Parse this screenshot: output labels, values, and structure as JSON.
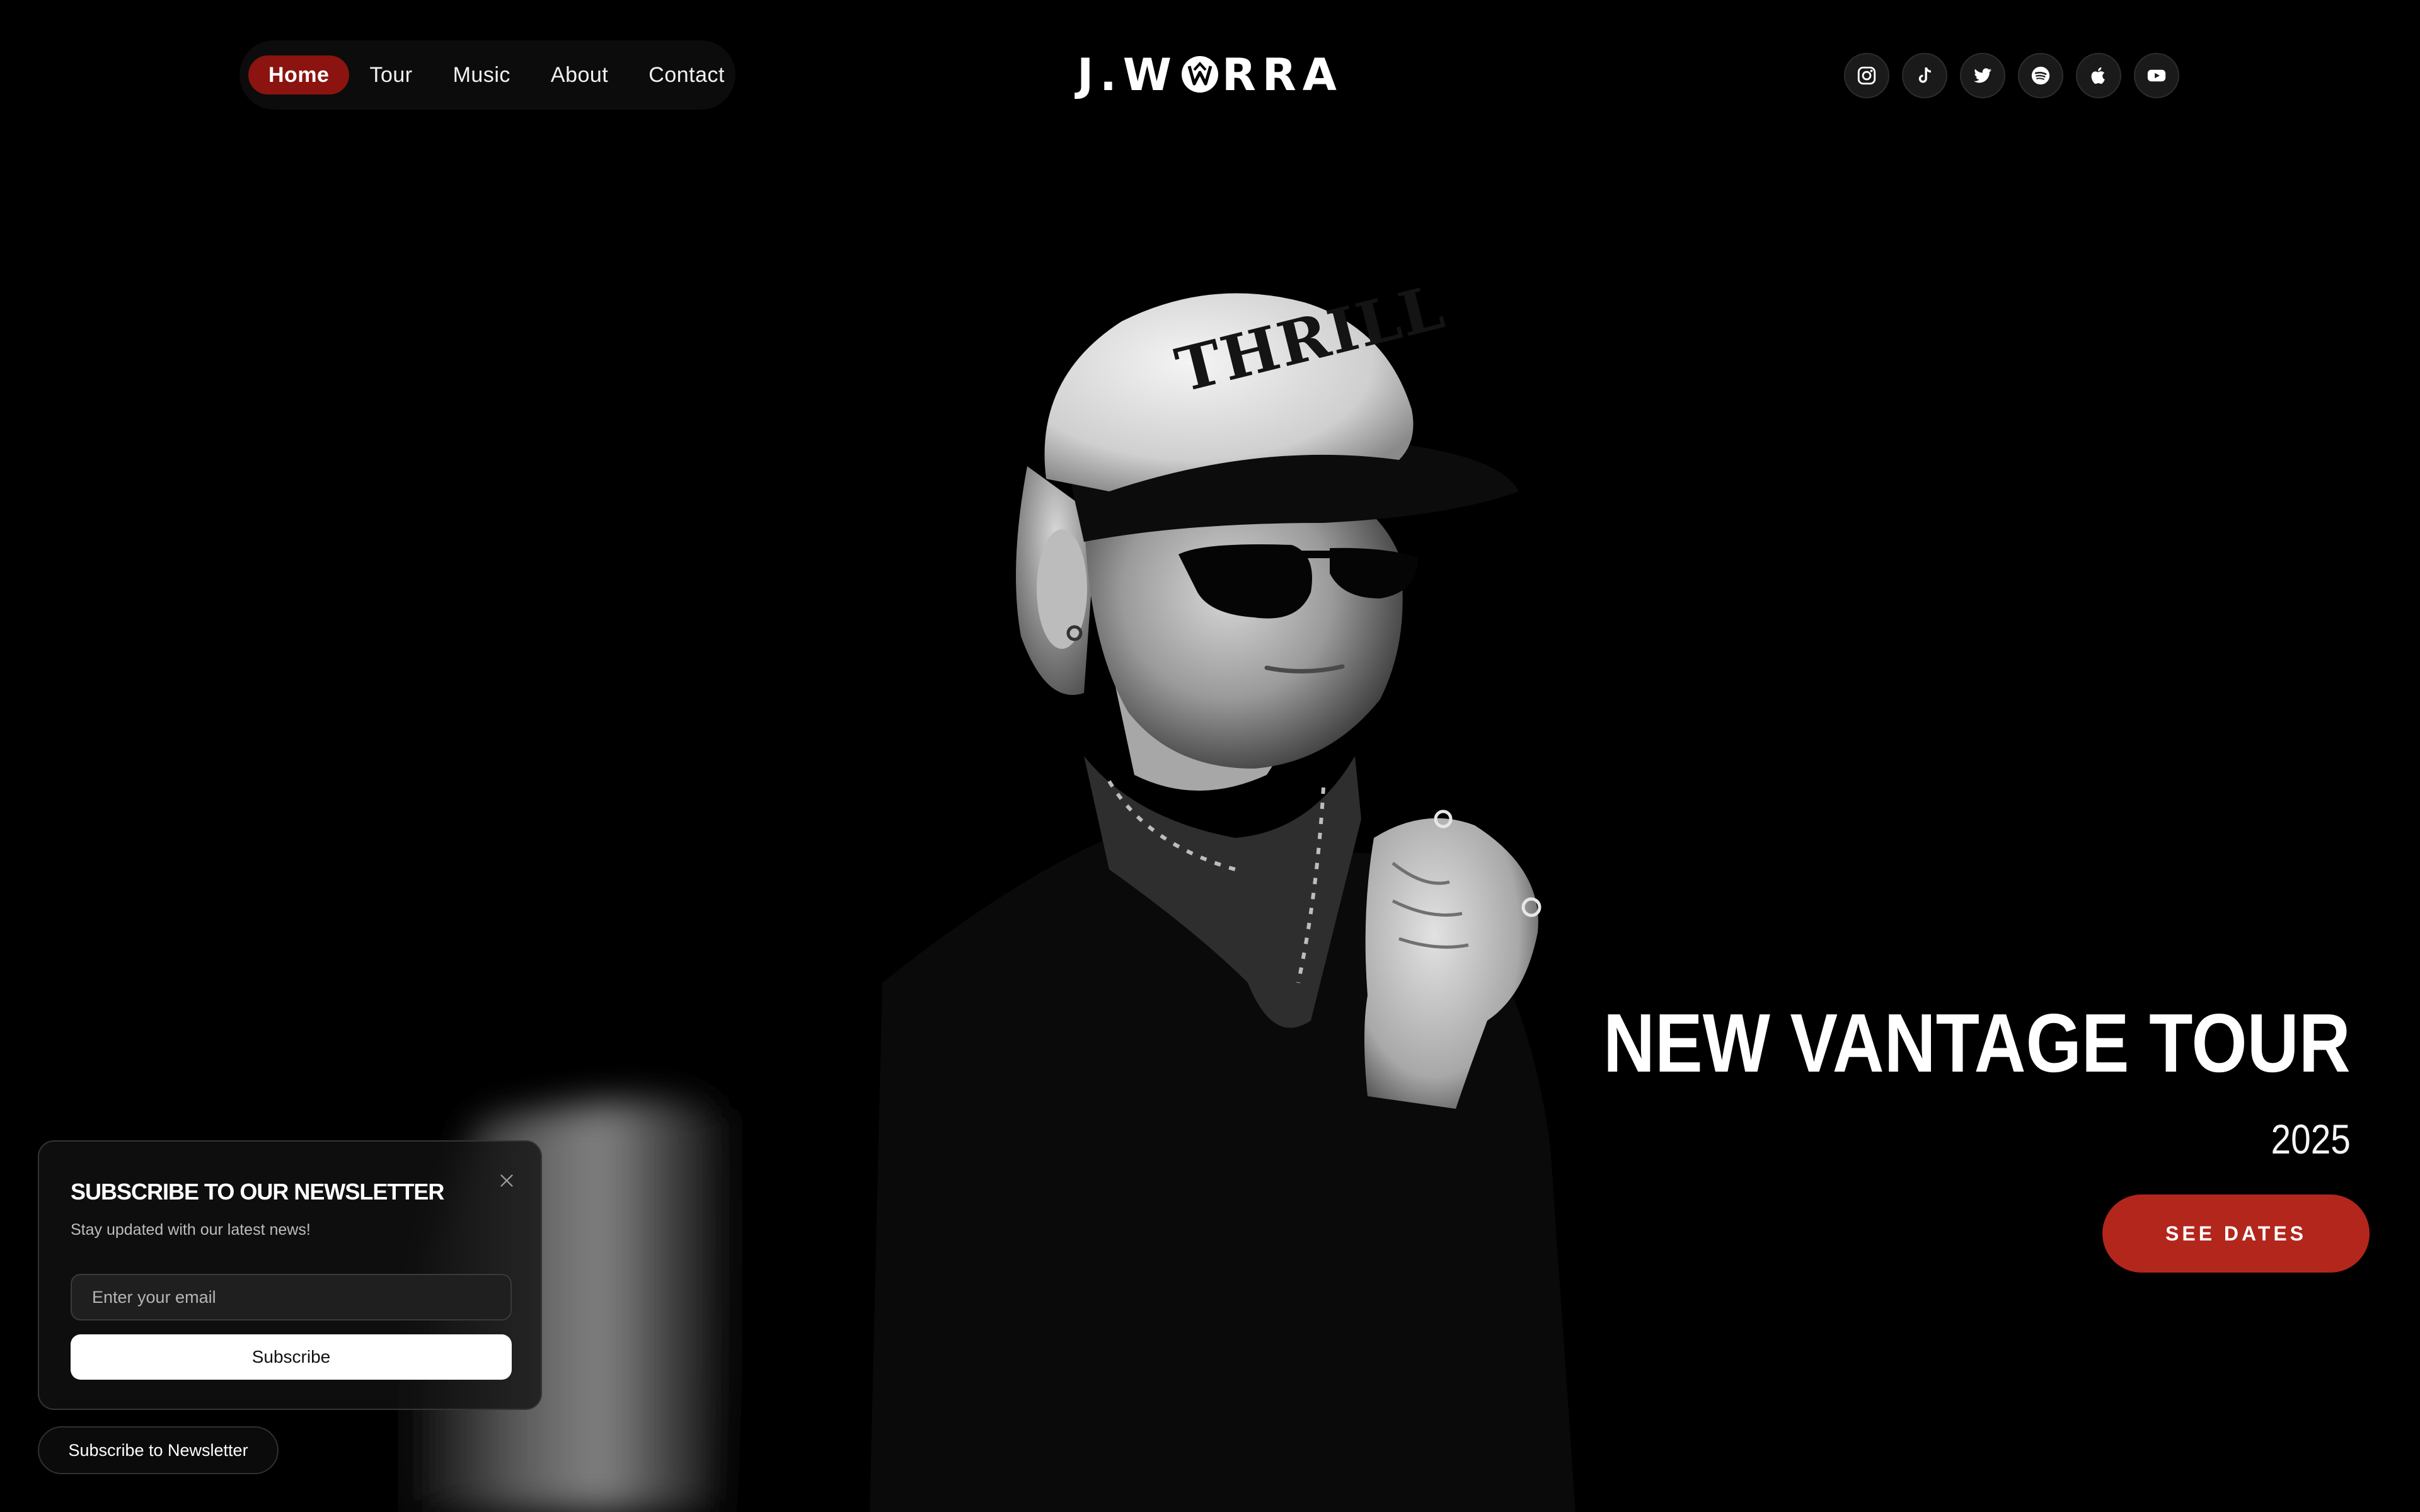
{
  "nav": {
    "items": [
      {
        "label": "Home",
        "active": true
      },
      {
        "label": "Tour",
        "active": false
      },
      {
        "label": "Music",
        "active": false
      },
      {
        "label": "About",
        "active": false
      },
      {
        "label": "Contact",
        "active": false
      }
    ]
  },
  "brand": {
    "logo_pre": "J.W",
    "logo_post": "RRA"
  },
  "social": [
    {
      "icon": "instagram-icon"
    },
    {
      "icon": "tiktok-icon"
    },
    {
      "icon": "twitter-icon"
    },
    {
      "icon": "spotify-icon"
    },
    {
      "icon": "apple-music-icon"
    },
    {
      "icon": "youtube-icon"
    }
  ],
  "hero": {
    "title": "NEW VANTAGE TOUR",
    "year": "2025",
    "cta_label": "SEE DATES",
    "cap_text": "THRILL"
  },
  "newsletter": {
    "title": "SUBSCRIBE TO OUR NEWSLETTER",
    "subtitle": "Stay updated with our latest news!",
    "email_placeholder": "Enter your email",
    "email_value": "",
    "subscribe_label": "Subscribe",
    "toggle_label": "Subscribe to Newsletter"
  },
  "colors": {
    "accent": "#b3261c",
    "nav_active": "#8b1410",
    "background": "#000000"
  }
}
